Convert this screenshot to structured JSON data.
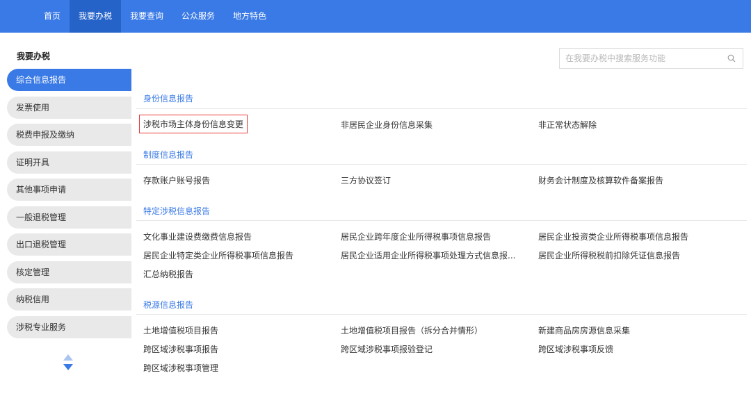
{
  "topnav": [
    {
      "label": "首页",
      "active": false
    },
    {
      "label": "我要办税",
      "active": true
    },
    {
      "label": "我要查询",
      "active": false
    },
    {
      "label": "公众服务",
      "active": false
    },
    {
      "label": "地方特色",
      "active": false
    }
  ],
  "sidebar": {
    "title": "我要办税",
    "items": [
      {
        "label": "综合信息报告",
        "active": true
      },
      {
        "label": "发票使用"
      },
      {
        "label": "税费申报及缴纳"
      },
      {
        "label": "证明开具"
      },
      {
        "label": "其他事项申请"
      },
      {
        "label": "一般退税管理"
      },
      {
        "label": "出口退税管理"
      },
      {
        "label": "核定管理"
      },
      {
        "label": "纳税信用"
      },
      {
        "label": "涉税专业服务"
      }
    ]
  },
  "search": {
    "placeholder": "在我要办税中搜索服务功能",
    "value": ""
  },
  "sections": [
    {
      "title": "身份信息报告",
      "links": [
        "涉税市场主体身份信息变更",
        "非居民企业身份信息采集",
        "非正常状态解除"
      ]
    },
    {
      "title": "制度信息报告",
      "links": [
        "存款账户账号报告",
        "三方协议签订",
        "财务会计制度及核算软件备案报告"
      ]
    },
    {
      "title": "特定涉税信息报告",
      "links": [
        "文化事业建设费缴费信息报告",
        "居民企业跨年度企业所得税事项信息报告",
        "居民企业投资类企业所得税事项信息报告",
        "居民企业特定类企业所得税事项信息报告",
        "居民企业适用企业所得税事项处理方式信息报...",
        "居民企业所得税税前扣除凭证信息报告",
        "汇总纳税报告"
      ]
    },
    {
      "title": "税源信息报告",
      "links": [
        "土地增值税项目报告",
        "土地增值税项目报告（拆分合并情形）",
        "新建商品房房源信息采集",
        "跨区域涉税事项报告",
        "跨区域涉税事项报验登记",
        "跨区域涉税事项反馈",
        "跨区域涉税事项管理"
      ]
    }
  ],
  "colors": {
    "primary": "#3a7ae6",
    "highlight_border": "#e53935"
  }
}
